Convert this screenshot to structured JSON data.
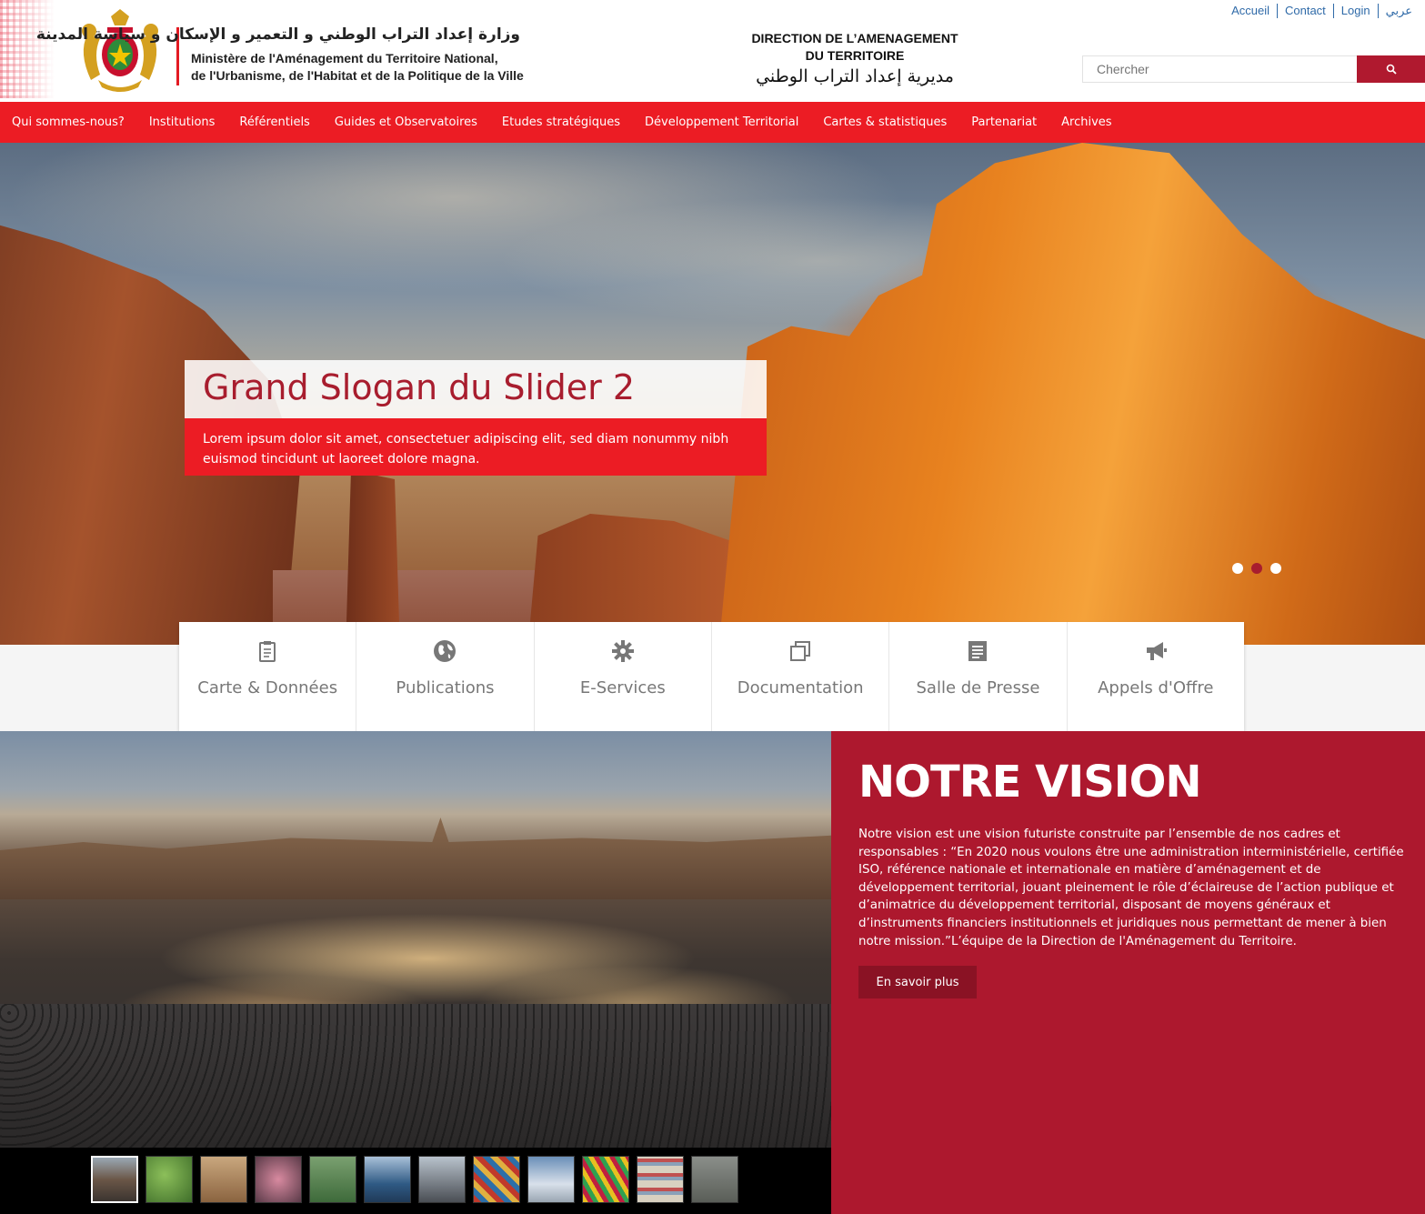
{
  "header": {
    "ministry_ar": "وزارة إعداد التراب الوطني و التعمير و الإسكان و سياسة المدينة",
    "ministry_fr_line1": "Ministère de l'Aménagement du Territoire National,",
    "ministry_fr_line2": "de l'Urbanisme, de l'Habitat et de la Politique de la Ville",
    "direction_fr_line1": "DIRECTION DE L’AMENAGEMENT",
    "direction_fr_line2": "DU TERRITOIRE",
    "direction_ar": "مديرية إعداد التراب الوطني",
    "top_links": [
      "Accueil",
      "Contact",
      "Login",
      "عربي"
    ],
    "search_placeholder": "Chercher",
    "search_icon": "search-icon"
  },
  "nav": {
    "items": [
      "Qui sommes-nous?",
      "Institutions",
      "Référentiels",
      "Guides et Observatoires",
      "Etudes stratégiques",
      "Développement Territorial",
      "Cartes & statistiques",
      "Partenariat",
      "Archives"
    ]
  },
  "hero": {
    "title": "Grand Slogan du Slider 2",
    "subtitle": "Lorem ipsum dolor sit amet, consectetuer adipiscing elit, sed diam nonummy nibh euismod tincidunt ut laoreet dolore magna.",
    "slides": 3,
    "active_slide": 2
  },
  "quick_links": [
    {
      "label": "Carte & Données",
      "icon": "clipboard-icon"
    },
    {
      "label": "Publications",
      "icon": "globe-icon"
    },
    {
      "label": "E-Services",
      "icon": "gear-icon"
    },
    {
      "label": "Documentation",
      "icon": "copy-icon"
    },
    {
      "label": "Salle de Presse",
      "icon": "newspaper-icon"
    },
    {
      "label": "Appels d'Offre",
      "icon": "megaphone-icon"
    }
  ],
  "gallery": {
    "thumbnails": 12,
    "active_thumbnail": 1
  },
  "vision": {
    "title": "NOTRE VISION",
    "text": "Notre vision est une vision futuriste construite par l’ensemble de nos cadres et responsables : “En 2020 nous voulons être une administration interministérielle, certifiée ISO, référence nationale et internationale en matière d’aménagement et de développement territorial, jouant pleinement le rôle d’éclaireuse de l’action publique et d’animatrice du développement territorial, disposant de moyens généraux et d’instruments financiers institutionnels et juridiques nous permettant de mener à bien notre mission.”L’équipe de la Direction de l'Aménagement du Territoire.",
    "button_label": "En savoir plus"
  },
  "colors": {
    "nav_red": "#ec1c24",
    "vision_red": "#ad182e",
    "accent_dark_red": "#a81d2e",
    "link_blue": "#2f6aa8"
  }
}
